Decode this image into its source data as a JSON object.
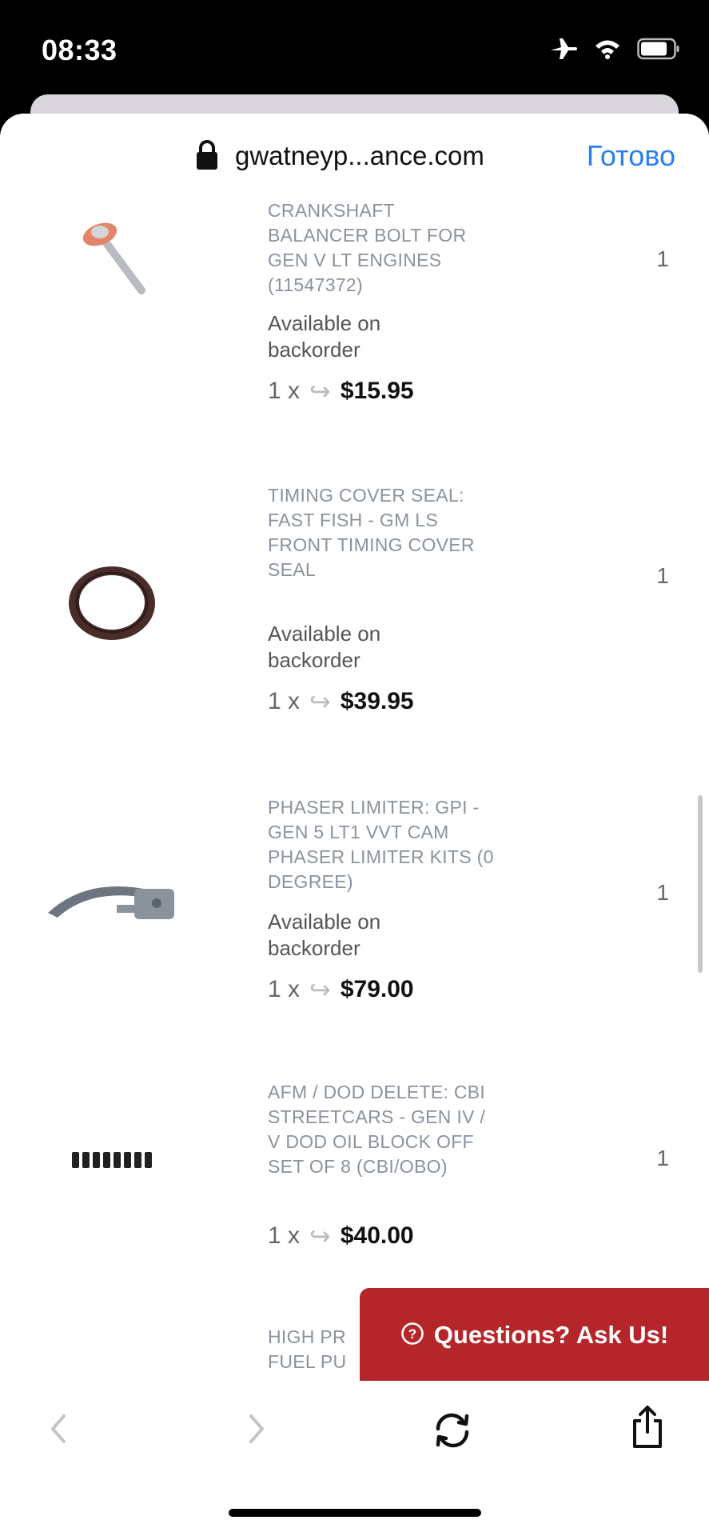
{
  "status_bar": {
    "time": "08:33",
    "icons": [
      "airplane-icon",
      "wifi-icon",
      "battery-icon"
    ]
  },
  "browser": {
    "domain": "gwatneyp...ance.com",
    "done_label": "Готово"
  },
  "cart_items": [
    {
      "title": "CRANKSHAFT BALANCER BOLT FOR GEN V LT ENGINES (11547372)",
      "availability": "Available on backorder",
      "multiplier": "1 x",
      "price": "$15.95",
      "quantity": "1",
      "icon": "bolt-image"
    },
    {
      "title": "TIMING COVER SEAL: FAST FISH - GM LS FRONT TIMING COVER SEAL",
      "availability": "Available on backorder",
      "multiplier": "1 x",
      "price": "$39.95",
      "quantity": "1",
      "icon": "seal-image"
    },
    {
      "title": "PHASER LIMITER: GPI - GEN 5 LT1 VVT CAM PHASER LIMITER KITS (0 DEGREE)",
      "availability": "Available on backorder",
      "multiplier": "1 x",
      "price": "$79.00",
      "quantity": "1",
      "icon": "limiter-image"
    },
    {
      "title": "AFM / DOD DELETE: CBI STREETCARS - GEN IV / V DOD OIL BLOCK OFF SET OF 8 (CBI/OBO)",
      "availability": "",
      "multiplier": "1 x",
      "price": "$40.00",
      "quantity": "1",
      "icon": "block-off-set-image"
    },
    {
      "title": "HIGH PR FUEL PU",
      "availability": "",
      "multiplier": "",
      "price": "",
      "quantity": "",
      "icon": ""
    }
  ],
  "chat_button": {
    "label": "Questions? Ask Us!",
    "icon": "question-circle-icon",
    "color": "#b4262a"
  },
  "toolbar": {
    "icons": [
      "back-arrow-icon",
      "forward-arrow-icon",
      "refresh-icon",
      "share-icon"
    ]
  }
}
